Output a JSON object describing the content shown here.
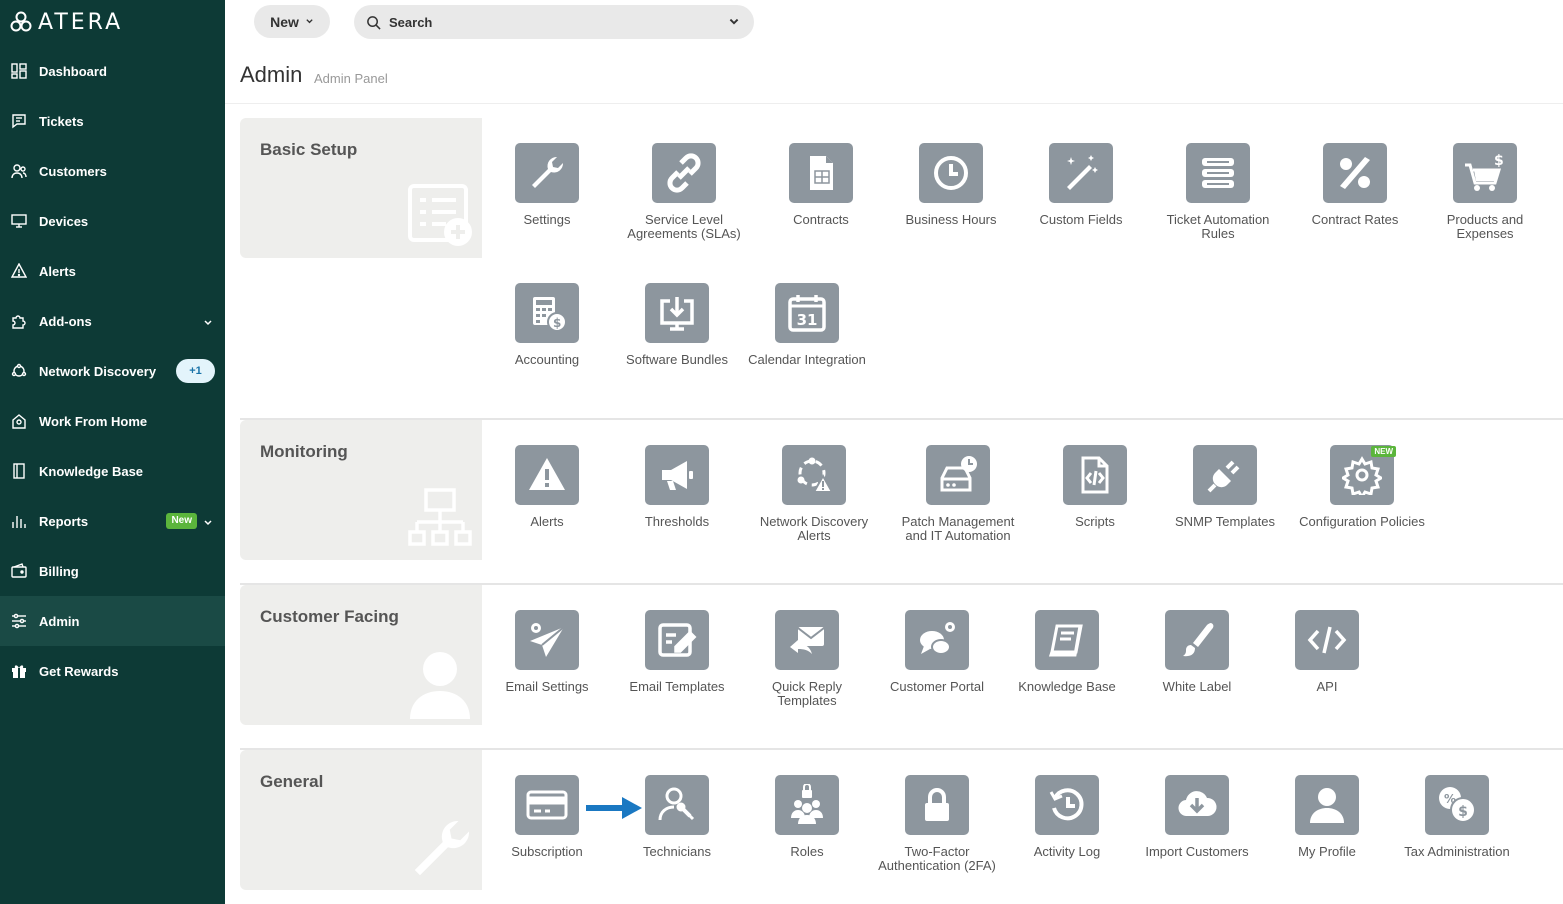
{
  "sidebar": {
    "logo_text": "ATERA",
    "items": [
      {
        "label": "Dashboard"
      },
      {
        "label": "Tickets"
      },
      {
        "label": "Customers"
      },
      {
        "label": "Devices"
      },
      {
        "label": "Alerts"
      },
      {
        "label": "Add-ons"
      },
      {
        "label": "Network Discovery",
        "badge": "+1"
      },
      {
        "label": "Work From Home"
      },
      {
        "label": "Knowledge Base"
      },
      {
        "label": "Reports",
        "badge": "New"
      },
      {
        "label": "Billing"
      },
      {
        "label": "Admin"
      },
      {
        "label": "Get Rewards"
      }
    ]
  },
  "topbar": {
    "new_label": "New",
    "search_label": "Search"
  },
  "page": {
    "title": "Admin",
    "subtitle": "Admin Panel"
  },
  "sections": [
    {
      "title": "Basic Setup",
      "tiles": [
        {
          "label": "Settings"
        },
        {
          "label": "Service Level Agreements (SLAs)"
        },
        {
          "label": "Contracts"
        },
        {
          "label": "Business Hours"
        },
        {
          "label": "Custom Fields"
        },
        {
          "label": "Ticket Automation Rules"
        },
        {
          "label": "Contract Rates"
        },
        {
          "label": "Products and Expenses"
        },
        {
          "label": "Accounting"
        },
        {
          "label": "Software Bundles"
        },
        {
          "label": "Calendar Integration",
          "icon_text": "31"
        }
      ]
    },
    {
      "title": "Monitoring",
      "tiles": [
        {
          "label": "Alerts"
        },
        {
          "label": "Thresholds"
        },
        {
          "label": "Network Discovery Alerts"
        },
        {
          "label": "Patch Management and IT Automation"
        },
        {
          "label": "Scripts"
        },
        {
          "label": "SNMP Templates"
        },
        {
          "label": "Configuration Policies",
          "flag": "NEW"
        }
      ]
    },
    {
      "title": "Customer Facing",
      "tiles": [
        {
          "label": "Email Settings"
        },
        {
          "label": "Email Templates"
        },
        {
          "label": "Quick Reply Templates"
        },
        {
          "label": "Customer Portal"
        },
        {
          "label": "Knowledge Base"
        },
        {
          "label": "White Label"
        },
        {
          "label": "API"
        }
      ]
    },
    {
      "title": "General",
      "tiles": [
        {
          "label": "Subscription"
        },
        {
          "label": "Technicians"
        },
        {
          "label": "Roles"
        },
        {
          "label": "Two-Factor Authentication (2FA)"
        },
        {
          "label": "Activity Log"
        },
        {
          "label": "Import Customers"
        },
        {
          "label": "My Profile"
        },
        {
          "label": "Tax Administration"
        }
      ]
    }
  ],
  "colors": {
    "sidebar_bg": "#0d3a36",
    "tile_bg": "#8d969e",
    "accent_new": "#5bb53c",
    "arrow": "#1a78c2"
  }
}
